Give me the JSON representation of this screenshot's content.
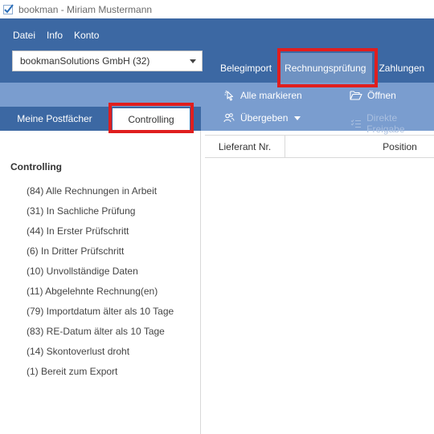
{
  "window": {
    "title": "bookman - Miriam Mustermann",
    "app_icon": "checkmark-logo-icon"
  },
  "menubar": {
    "items": [
      "Datei",
      "Info",
      "Konto"
    ]
  },
  "company_select": {
    "value": "bookmanSolutions GmbH (32)"
  },
  "main_tabs": {
    "items": [
      "Belegimport",
      "Rechnungsprüfung",
      "Zahlungen"
    ],
    "active": "Rechnungsprüfung"
  },
  "toolbar": {
    "select_all_label": "Alle markieren",
    "handover_label": "Übergeben",
    "open_label": "Öffnen",
    "direct_release_label": "Direkte Freigabe"
  },
  "left_tabs": {
    "mailboxes_label": "Meine Postfächer",
    "controlling_label": "Controlling"
  },
  "left_panel": {
    "heading": "Controlling",
    "items": [
      "(84) Alle Rechnungen in Arbeit",
      "(31) In Sachliche Prüfung",
      "(44) In Erster Prüfschritt",
      "(6) In Dritter Prüfschritt",
      "(10) Unvollständige Daten",
      "(11) Abgelehnte Rechnung(en)",
      "(79) Importdatum älter als 10 Tage",
      "(83) RE-Datum älter als 10 Tage",
      "(14) Skontoverlust droht",
      "(1) Bereit zum Export"
    ]
  },
  "grid": {
    "columns": [
      "Lieferant Nr.",
      "Position"
    ]
  },
  "colors": {
    "header_blue": "#3c68a3",
    "toolbar_blue": "#7a9dcf",
    "active_tab": "#6f92c2",
    "highlight_red": "#e01e1e"
  }
}
